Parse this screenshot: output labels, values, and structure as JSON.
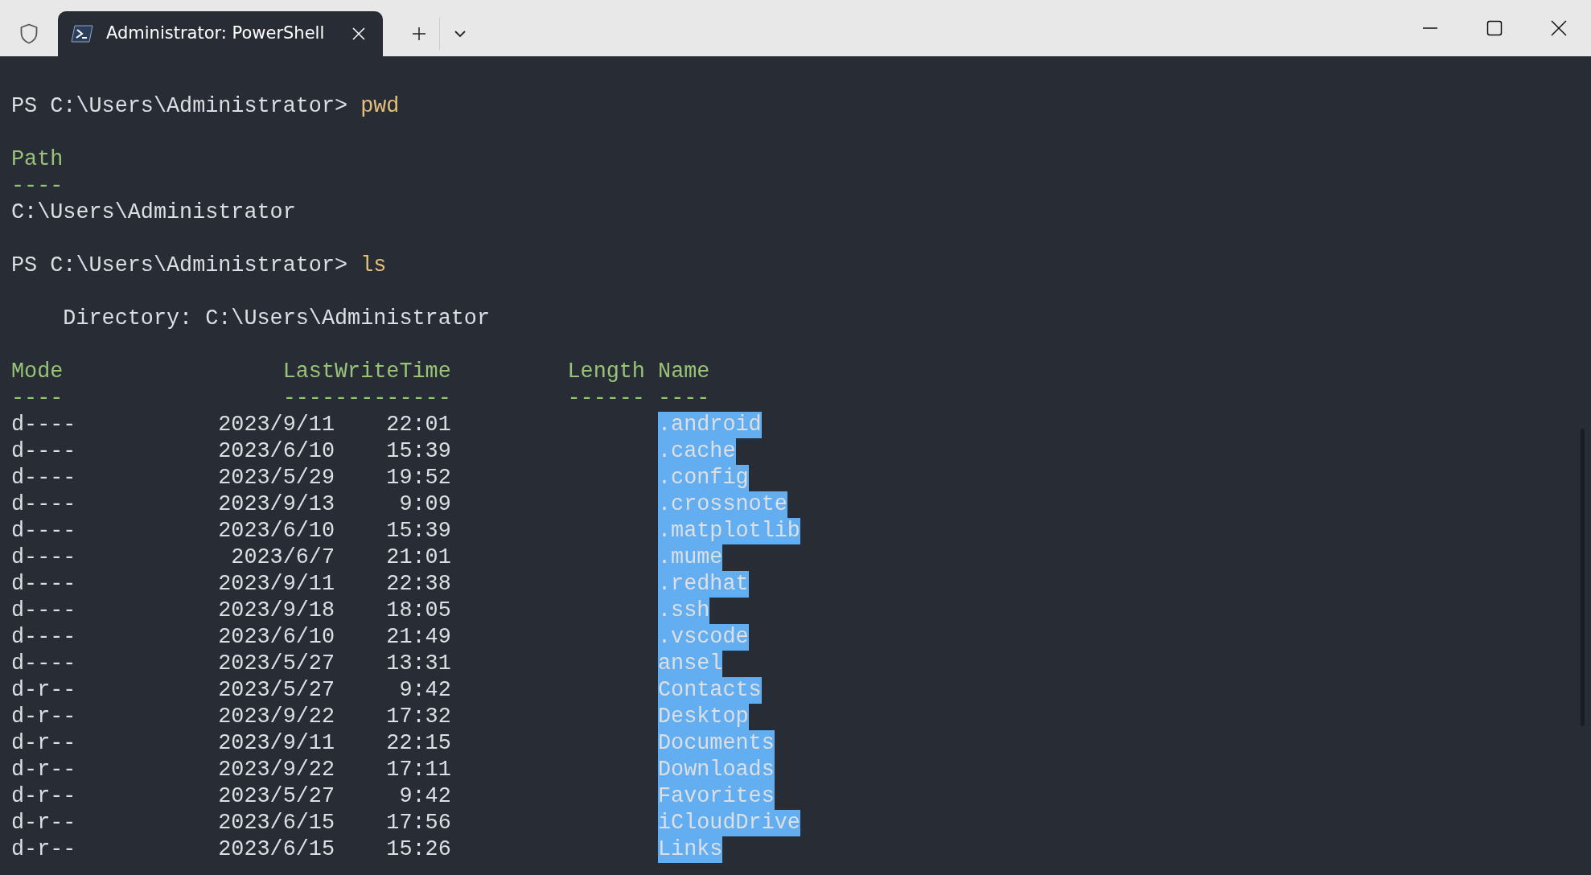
{
  "window": {
    "tab": {
      "title": "Administrator: PowerShell",
      "selected": true
    }
  },
  "terminal": {
    "lines": [
      {
        "kind": "blank"
      },
      {
        "kind": "prompt",
        "prompt": "PS C:\\Users\\Administrator>",
        "command": "pwd"
      },
      {
        "kind": "blank"
      },
      {
        "kind": "heading",
        "text": "Path"
      },
      {
        "kind": "heading",
        "text": "----"
      },
      {
        "kind": "output",
        "text": "C:\\Users\\Administrator"
      },
      {
        "kind": "blank"
      },
      {
        "kind": "prompt",
        "prompt": "PS C:\\Users\\Administrator>",
        "command": "ls"
      },
      {
        "kind": "blank"
      },
      {
        "kind": "directory",
        "text": "Directory: C:\\Users\\Administrator"
      },
      {
        "kind": "blank"
      }
    ],
    "listing": {
      "columns": [
        "Mode",
        "LastWriteTime",
        "Length",
        "Name"
      ],
      "rules": [
        "----",
        "-------------",
        "------",
        "----"
      ],
      "rows": [
        {
          "mode": "d----",
          "date": "2023/9/11",
          "time": "22:01",
          "name": ".android",
          "selected": true
        },
        {
          "mode": "d----",
          "date": "2023/6/10",
          "time": "15:39",
          "name": ".cache",
          "selected": true
        },
        {
          "mode": "d----",
          "date": "2023/5/29",
          "time": "19:52",
          "name": ".config",
          "selected": true
        },
        {
          "mode": "d----",
          "date": "2023/9/13",
          "time": "9:09",
          "name": ".crossnote",
          "selected": true
        },
        {
          "mode": "d----",
          "date": "2023/6/10",
          "time": "15:39",
          "name": ".matplotlib",
          "selected": true
        },
        {
          "mode": "d----",
          "date": "2023/6/7",
          "time": "21:01",
          "name": ".mume",
          "selected": true
        },
        {
          "mode": "d----",
          "date": "2023/9/11",
          "time": "22:38",
          "name": ".redhat",
          "selected": true
        },
        {
          "mode": "d----",
          "date": "2023/9/18",
          "time": "18:05",
          "name": ".ssh",
          "selected": true
        },
        {
          "mode": "d----",
          "date": "2023/6/10",
          "time": "21:49",
          "name": ".vscode",
          "selected": true
        },
        {
          "mode": "d----",
          "date": "2023/5/27",
          "time": "13:31",
          "name": "ansel",
          "selected": true
        },
        {
          "mode": "d-r--",
          "date": "2023/5/27",
          "time": "9:42",
          "name": "Contacts",
          "selected": true
        },
        {
          "mode": "d-r--",
          "date": "2023/9/22",
          "time": "17:32",
          "name": "Desktop",
          "selected": true
        },
        {
          "mode": "d-r--",
          "date": "2023/9/11",
          "time": "22:15",
          "name": "Documents",
          "selected": true
        },
        {
          "mode": "d-r--",
          "date": "2023/9/22",
          "time": "17:11",
          "name": "Downloads",
          "selected": true
        },
        {
          "mode": "d-r--",
          "date": "2023/5/27",
          "time": "9:42",
          "name": "Favorites",
          "selected": true
        },
        {
          "mode": "d-r--",
          "date": "2023/6/15",
          "time": "17:56",
          "name": "iCloudDrive",
          "selected": true
        },
        {
          "mode": "d-r--",
          "date": "2023/6/15",
          "time": "15:26",
          "name": "Links",
          "selected": true
        }
      ]
    }
  }
}
